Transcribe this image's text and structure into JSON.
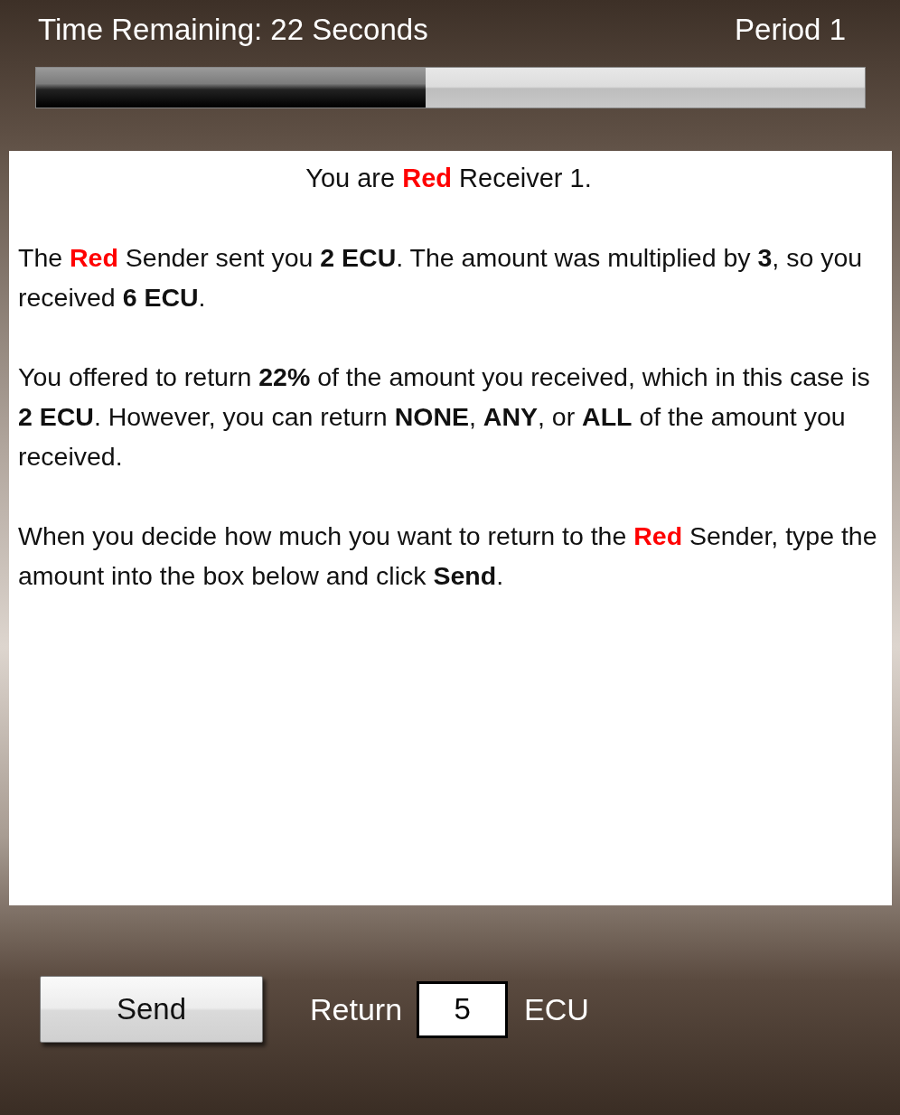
{
  "header": {
    "time_remaining": "Time Remaining: 22 Seconds",
    "period": "Period 1",
    "timer": {
      "level": 0.47
    }
  },
  "message": {
    "title": [
      {
        "text": "You are ",
        "kind": "plain"
      },
      {
        "text": "Red",
        "kind": "red"
      },
      {
        "text": " Receiver 1.",
        "kind": "plain"
      }
    ],
    "paragraphs": [
      [
        {
          "text": "The ",
          "kind": "plain"
        },
        {
          "text": "Red",
          "kind": "red"
        },
        {
          "text": " Sender sent you ",
          "kind": "plain"
        },
        {
          "text": "2 ECU",
          "kind": "bold"
        },
        {
          "text": ". The amount was multiplied by ",
          "kind": "plain"
        },
        {
          "text": "3",
          "kind": "bold"
        },
        {
          "text": ", so you received ",
          "kind": "plain"
        },
        {
          "text": "6 ECU",
          "kind": "bold"
        },
        {
          "text": ".",
          "kind": "plain"
        }
      ],
      [
        {
          "text": "You offered to return ",
          "kind": "plain"
        },
        {
          "text": "22%",
          "kind": "bold"
        },
        {
          "text": " of the amount you received, which in this case is ",
          "kind": "plain"
        },
        {
          "text": "2 ECU",
          "kind": "bold"
        },
        {
          "text": ". However, you can return ",
          "kind": "plain"
        },
        {
          "text": "NONE",
          "kind": "bold"
        },
        {
          "text": ", ",
          "kind": "plain"
        },
        {
          "text": "ANY",
          "kind": "bold"
        },
        {
          "text": ", or ",
          "kind": "plain"
        },
        {
          "text": "ALL",
          "kind": "bold"
        },
        {
          "text": " of the amount you received.",
          "kind": "plain"
        }
      ],
      [
        {
          "text": "When you decide how much you want to return to the ",
          "kind": "plain"
        },
        {
          "text": "Red",
          "kind": "red"
        },
        {
          "text": " Sender, type the amount into the box below and click ",
          "kind": "plain"
        },
        {
          "text": "Send",
          "kind": "bold"
        },
        {
          "text": ".",
          "kind": "plain"
        }
      ]
    ]
  },
  "footer": {
    "send_button": "Send",
    "return_label": "Return",
    "amount": {
      "value": "5"
    },
    "unit": "ECU"
  }
}
